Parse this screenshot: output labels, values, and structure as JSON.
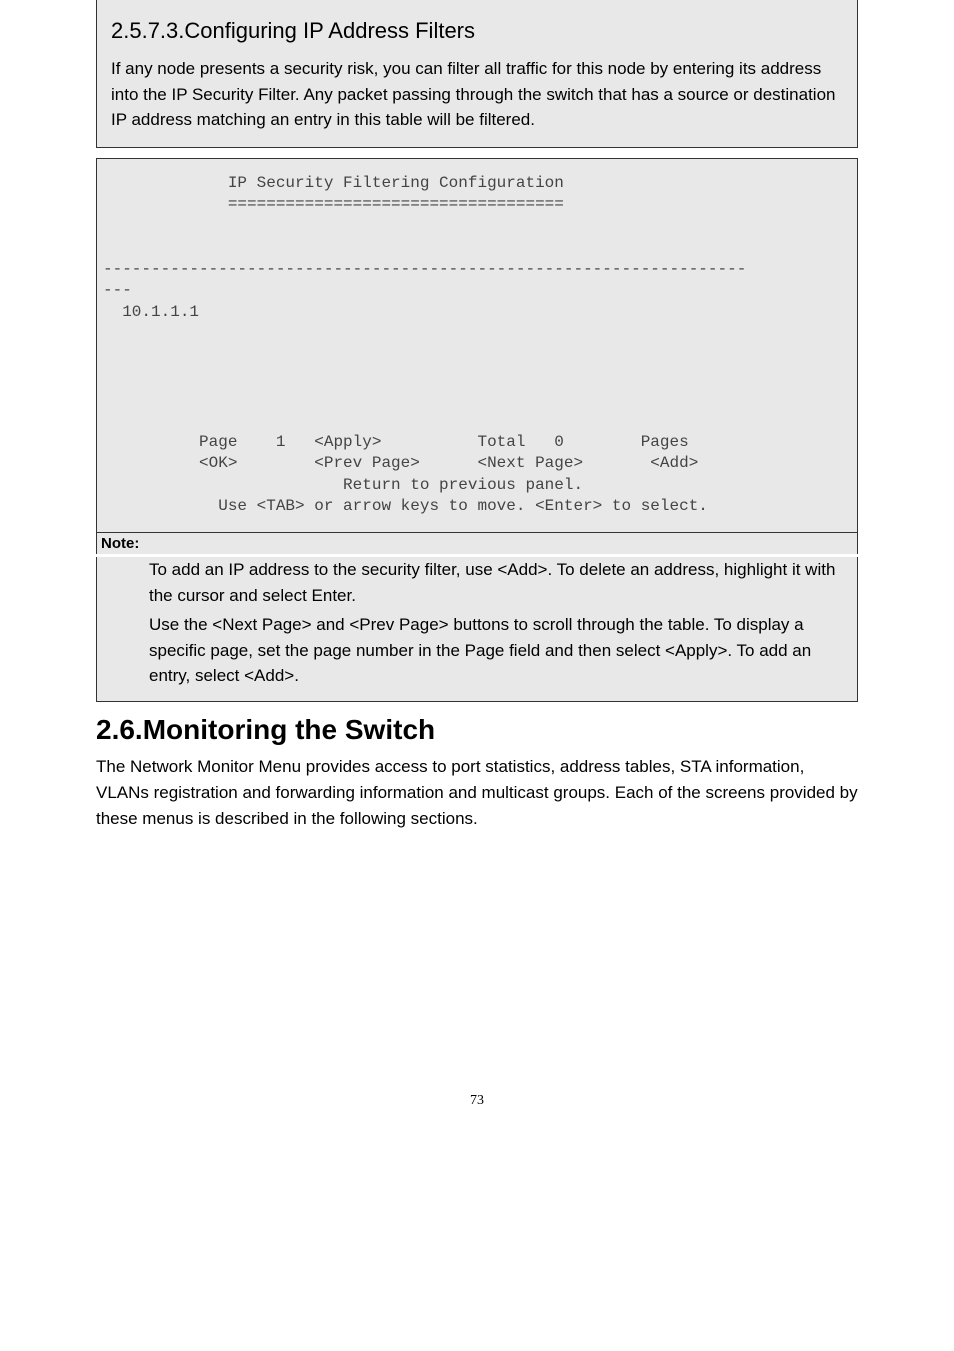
{
  "subsection": {
    "title": "2.5.7.3.Configuring IP Address Filters",
    "intro": "If any node presents a security risk, you can filter all traffic for this node by entering its address into the IP Security Filter. Any packet passing through the switch that has a source or destination IP address matching an entry in this table will be filtered."
  },
  "console": "             IP Security Filtering Configuration\n             ===================================\n\n\n-------------------------------------------------------------------\n---\n  10.1.1.1\n\n\n\n\n\n          Page    1   <Apply>          Total   0        Pages\n          <OK>        <Prev Page>      <Next Page>       <Add>\n                         Return to previous panel.\n            Use <TAB> or arrow keys to move. <Enter> to select.",
  "note": {
    "label": "Note:",
    "p1": "To add an IP address to the security filter, use <Add>. To delete an address, highlight it with the cursor and select Enter.",
    "p2": "Use the <Next Page> and <Prev Page> buttons to scroll through the table. To display a specific page, set the page number in the Page field and then select <Apply>. To add an entry, select <Add>."
  },
  "section": {
    "title": "2.6.Monitoring the Switch",
    "body": "The Network Monitor Menu provides access to port statistics, address tables, STA information, VLANs registration and forwarding information and multicast groups. Each of the screens provided by these menus is described in the following sections."
  },
  "page_number": "73"
}
